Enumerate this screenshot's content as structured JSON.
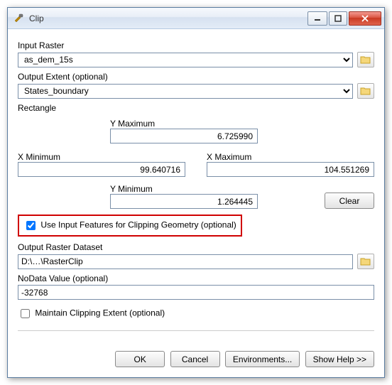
{
  "window": {
    "title": "Clip"
  },
  "inputRaster": {
    "label": "Input Raster",
    "value": "as_dem_15s"
  },
  "outputExtent": {
    "label": "Output Extent (optional)",
    "value": "States_boundary"
  },
  "rectangle": {
    "label": "Rectangle",
    "ymax_label": "Y Maximum",
    "ymax": "6.725990",
    "xmin_label": "X Minimum",
    "xmin": "99.640716",
    "xmax_label": "X Maximum",
    "xmax": "104.551269",
    "ymin_label": "Y Minimum",
    "ymin": "1.264445",
    "clear_label": "Clear"
  },
  "useInputFeatures": {
    "label": "Use Input Features for Clipping Geometry (optional)",
    "checked": true
  },
  "outputDataset": {
    "label": "Output Raster Dataset",
    "value": "D:\\…\\RasterClip"
  },
  "nodata": {
    "label": "NoData Value (optional)",
    "value": "-32768"
  },
  "maintainExtent": {
    "label": "Maintain Clipping Extent (optional)",
    "checked": false
  },
  "buttons": {
    "ok": "OK",
    "cancel": "Cancel",
    "env": "Environments...",
    "help": "Show Help >>"
  },
  "icons": {
    "hammer": "hammer-icon",
    "folder": "folder-icon"
  }
}
